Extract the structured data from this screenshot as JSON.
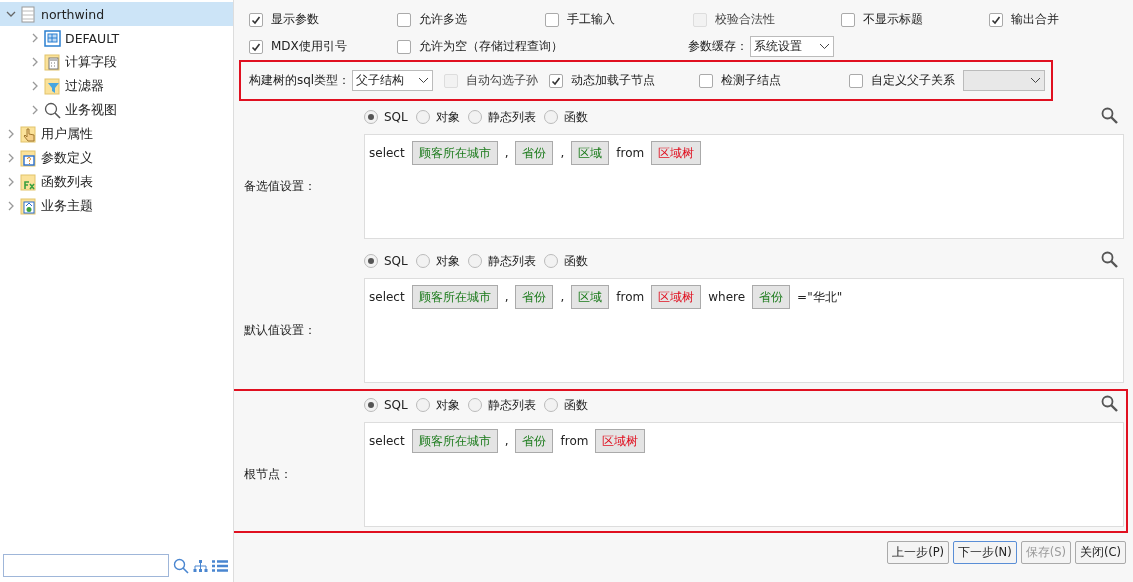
{
  "tree": [
    {
      "label": "northwind",
      "kind": "database",
      "expanded": true,
      "selected": true,
      "children": [
        {
          "label": "DEFAULT",
          "kind": "table",
          "expanded": false,
          "selected": false
        },
        {
          "label": "计算字段",
          "kind": "calculator",
          "expanded": false,
          "selected": false
        },
        {
          "label": "过滤器",
          "kind": "funnel",
          "expanded": false,
          "selected": false
        },
        {
          "label": "业务视图",
          "kind": "magnifier",
          "expanded": false,
          "selected": false
        }
      ]
    },
    {
      "label": "用户属性",
      "kind": "hand",
      "expanded": false,
      "selected": false
    },
    {
      "label": "参数定义",
      "kind": "question",
      "expanded": false,
      "selected": false
    },
    {
      "label": "函数列表",
      "kind": "function",
      "expanded": false,
      "selected": false
    },
    {
      "label": "业务主题",
      "kind": "theme",
      "expanded": false,
      "selected": false
    }
  ],
  "options_row_1": [
    {
      "kind": "checkbox",
      "label": "显示参数",
      "checked": true,
      "disabled": false
    },
    {
      "kind": "checkbox",
      "label": "允许多选",
      "checked": false,
      "disabled": false
    },
    {
      "kind": "checkbox",
      "label": "手工输入",
      "checked": false,
      "disabled": false
    },
    {
      "kind": "checkbox",
      "label": "校验合法性",
      "checked": false,
      "disabled": true
    },
    {
      "kind": "checkbox",
      "label": "不显示标题",
      "checked": false,
      "disabled": false
    },
    {
      "kind": "checkbox",
      "label": "输出合并",
      "checked": true,
      "disabled": false
    }
  ],
  "options_row_2": [
    {
      "kind": "checkbox",
      "label": "MDX使用引号",
      "checked": true,
      "disabled": false
    },
    {
      "kind": "checkbox",
      "label": "允许为空（存储过程查询）",
      "checked": false,
      "disabled": false
    },
    {
      "kind": "select",
      "label": "参数缓存：",
      "value": "系统设置",
      "disabled": false
    }
  ],
  "tree_options": {
    "highlighted": true,
    "label": "构建树的sql类型：",
    "value": "父子结构",
    "items": [
      {
        "kind": "checkbox",
        "label": "自动勾选子孙",
        "checked": false,
        "disabled": true
      },
      {
        "kind": "checkbox",
        "label": "动态加载子节点",
        "checked": true,
        "disabled": false
      },
      {
        "kind": "checkbox",
        "label": "检测子结点",
        "checked": false,
        "disabled": false
      },
      {
        "kind": "checkbox",
        "label": "自定义父子关系",
        "checked": false,
        "disabled": false,
        "select_disabled": true
      }
    ]
  },
  "sections": [
    {
      "label": "备选值设置：",
      "highlighted": false,
      "sources": [
        {
          "label": "SQL",
          "selected": true
        },
        {
          "label": "对象",
          "selected": false
        },
        {
          "label": "静态列表",
          "selected": false
        },
        {
          "label": "函数",
          "selected": false
        }
      ],
      "tokens": [
        {
          "kind": "keyword",
          "text": "select"
        },
        {
          "kind": "field",
          "text": "顾客所在城市"
        },
        {
          "kind": "keyword",
          "text": ","
        },
        {
          "kind": "field",
          "text": "省份"
        },
        {
          "kind": "keyword",
          "text": ","
        },
        {
          "kind": "field",
          "text": "区域"
        },
        {
          "kind": "keyword",
          "text": "from"
        },
        {
          "kind": "table",
          "text": "区域树"
        }
      ]
    },
    {
      "label": "默认值设置：",
      "highlighted": false,
      "sources": [
        {
          "label": "SQL",
          "selected": true
        },
        {
          "label": "对象",
          "selected": false
        },
        {
          "label": "静态列表",
          "selected": false
        },
        {
          "label": "函数",
          "selected": false
        }
      ],
      "tokens": [
        {
          "kind": "keyword",
          "text": "select"
        },
        {
          "kind": "field",
          "text": "顾客所在城市"
        },
        {
          "kind": "keyword",
          "text": ","
        },
        {
          "kind": "field",
          "text": "省份"
        },
        {
          "kind": "keyword",
          "text": ","
        },
        {
          "kind": "field",
          "text": "区域"
        },
        {
          "kind": "keyword",
          "text": "from"
        },
        {
          "kind": "table",
          "text": "区域树"
        },
        {
          "kind": "keyword",
          "text": "where"
        },
        {
          "kind": "param",
          "text": "省份"
        },
        {
          "kind": "keyword",
          "text": "=\"华北\""
        }
      ]
    },
    {
      "label": "根节点：",
      "highlighted": true,
      "sources": [
        {
          "label": "SQL",
          "selected": true
        },
        {
          "label": "对象",
          "selected": false
        },
        {
          "label": "静态列表",
          "selected": false
        },
        {
          "label": "函数",
          "selected": false
        }
      ],
      "tokens": [
        {
          "kind": "keyword",
          "text": "select"
        },
        {
          "kind": "field",
          "text": "顾客所在城市"
        },
        {
          "kind": "keyword",
          "text": ","
        },
        {
          "kind": "field",
          "text": "省份"
        },
        {
          "kind": "keyword",
          "text": "from"
        },
        {
          "kind": "table",
          "text": "区域树"
        }
      ]
    }
  ],
  "buttons": [
    {
      "label": "上一步(P)",
      "disabled": false,
      "primary": false
    },
    {
      "label": "下一步(N)",
      "disabled": false,
      "primary": true
    },
    {
      "label": "保存(S)",
      "disabled": true,
      "primary": false
    },
    {
      "label": "关闭(C)",
      "disabled": false,
      "primary": false
    }
  ]
}
